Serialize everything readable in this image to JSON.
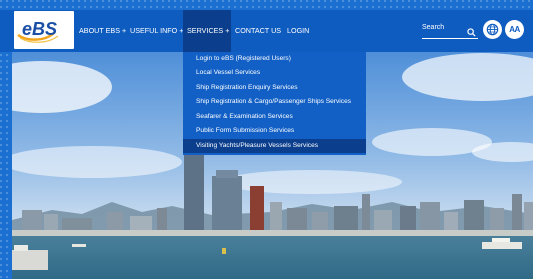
{
  "brand": {
    "logo_text": "eBS"
  },
  "nav": {
    "items": [
      {
        "label": "ABOUT EBS +"
      },
      {
        "label": "USEFUL INFO +"
      },
      {
        "label": "SERVICES +",
        "active": true
      },
      {
        "label": "CONTACT US"
      },
      {
        "label": "LOGIN"
      }
    ]
  },
  "search": {
    "label": "Search",
    "icon": "search-icon"
  },
  "utility": {
    "language_icon": "globe-icon",
    "font_size_label": "AA"
  },
  "services_menu": {
    "items": [
      {
        "label": "Login to eBS (Registered Users)"
      },
      {
        "label": "Local Vessel Services"
      },
      {
        "label": "Ship Registration Enquiry Services"
      },
      {
        "label": "Ship Registration & Cargo/Passenger Ships Services"
      },
      {
        "label": "Seafarer & Examination Services"
      },
      {
        "label": "Public Form Submission Services"
      },
      {
        "label": "Visiting Yachts/Pleasure Vessels Services",
        "highlighted": true
      }
    ]
  },
  "colors": {
    "nav_blue": "#0f5cc0",
    "active_navy": "#0b3f8e",
    "frame_blue": "#1b6fd0"
  }
}
